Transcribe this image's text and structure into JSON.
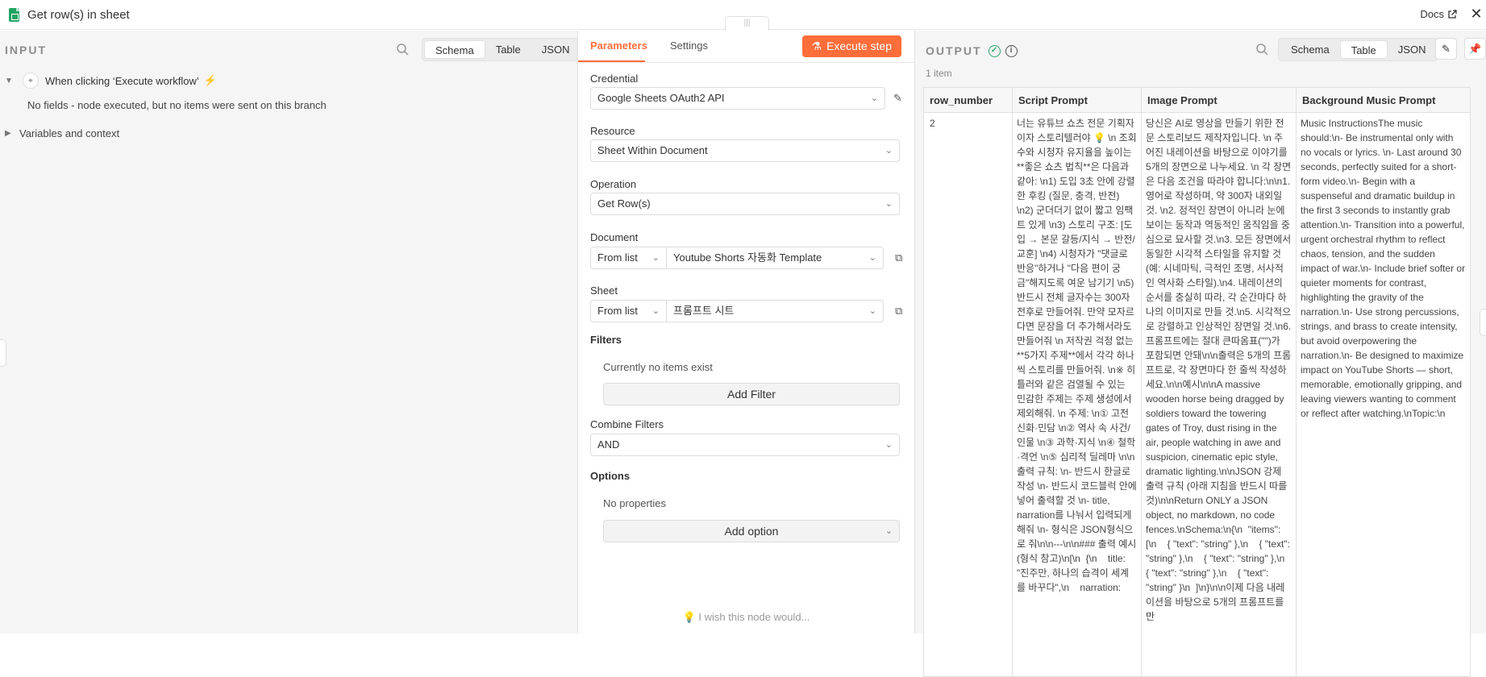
{
  "header": {
    "title": "Get row(s) in sheet",
    "docs_label": "Docs",
    "close_glyph": "✕"
  },
  "input": {
    "heading": "INPUT",
    "view_tabs": [
      "Schema",
      "Table",
      "JSON"
    ],
    "active_tab": "Schema",
    "trigger_label": "When clicking ‘Execute workflow’",
    "no_fields_text": "No fields - node executed, but no items were sent on this branch",
    "variables_label": "Variables and context"
  },
  "params": {
    "tabs": [
      "Parameters",
      "Settings"
    ],
    "execute_label": "Execute step",
    "credential_label": "Credential",
    "credential_value": "Google Sheets OAuth2 API",
    "resource_label": "Resource",
    "resource_value": "Sheet Within Document",
    "operation_label": "Operation",
    "operation_value": "Get Row(s)",
    "document_label": "Document",
    "document_mode": "From list",
    "document_value": "Youtube Shorts 자동화 Template",
    "sheet_label": "Sheet",
    "sheet_mode": "From list",
    "sheet_value": "프롬프트 시트",
    "filters_label": "Filters",
    "filters_empty": "Currently no items exist",
    "add_filter_label": "Add Filter",
    "combine_label": "Combine Filters",
    "combine_value": "AND",
    "options_label": "Options",
    "options_empty": "No properties",
    "add_option_label": "Add option",
    "wish_text": "I wish this node would..."
  },
  "output": {
    "heading": "OUTPUT",
    "view_tabs": [
      "Schema",
      "Table",
      "JSON"
    ],
    "active_tab": "Table",
    "item_count": "1 item",
    "columns": [
      "row_number",
      "Script Prompt",
      "Image Prompt",
      "Background Music Prompt"
    ],
    "row": {
      "row_number": "2",
      "script_prompt": "너는 유튜브 쇼츠 전문 기획자이자 스토리텔러야 💡 \\n 조회수와 시청자 유지율을 높이는 **좋은 쇼츠 법칙**은 다음과 같아: \\n1) 도입 3초 안에 강렬한 후킹 (질문, 충격, 반전) \\n2) 군더더기 없이 짧고 임팩트 있게 \\n3) 스토리 구조: [도입 → 본문 갈등/지식 → 반전/교훈] \\n4) 시청자가 \"댓글로 반응\"하거나 \"다음 편이 궁금\"해지도록 여운 남기기 \\n5) 반드시 전체 글자수는 300자 전후로 만들어줘. 만약 모자르다면 문장을 더 추가해서라도 만들어줘 \\n 저작권 걱정 없는 **5가지 주제**에서 각각 하나씩 스토리를 만들어줘. \\n※ 히틀러와 같은 검열될 수 있는 민감한 주제는 주제 생성에서 제외해줘. \\n 주제: \\n① 고전 신화·민담 \\n② 역사 속 사건/인물 \\n③ 과학·지식 \\n④ 철학·격언 \\n⑤ 심리적 딜레마 \\n\\n출력 규칙: \\n- 반드시 한글로 작성 \\n- 반드시 코드블럭 안에 넣어 출력할 것 \\n- title, narration를 나눠서 입력되게 해줘 \\n- 형식은 JSON형식으로 줘\\n\\n---\\n\\n### 출력 예시 (형식 참고)\\n[\\n  {\\n    title: \"진주만, 하나의 습격이 세계를 바꾸다\",\\n    narration:",
      "image_prompt": "당신은 AI로 영상을 만들기 위한 전문 스토리보드 제작자입니다. \\n 주어진 내레이션을 바탕으로 이야기를 5개의 장면으로 나누세요. \\n 각 장면은 다음 조건을 따라야 합니다:\\n\\n1. 영어로 작성하며, 약 300자 내외일 것. \\n2. 정적인 장면이 아니라 눈에 보이는 동작과 역동적인 움직임을 중심으로 묘사할 것.\\n3. 모든 장면에서 동일한 시각적 스타일을 유지할 것 (예: 시네마틱, 극적인 조명, 서사적인 역사화 스타일).\\n4. 내레이션의 순서를 충실히 따라, 각 순간마다 하나의 이미지로 만들 것.\\n5. 시각적으로 강렬하고 인상적인 장면일 것.\\n6. 프롬프트에는 절대 큰따옴표(\"\")가 포함되면 안돼\\n\\n출력은 5개의 프롬프트로, 각 장면마다 한 줄씩 작성하세요.\\n\\n예시\\n\\nA massive wooden horse being dragged by soldiers toward the towering gates of Troy, dust rising in the air, people watching in awe and suspicion, cinematic epic style, dramatic lighting.\\n\\nJSON 강제 출력 규칙 (아래 지침을 반드시 따를 것)\\n\\nReturn ONLY a JSON object, no markdown, no code fences.\\nSchema:\\n{\\n  \"items\": [\\n    { \"text\": \"string\" },\\n    { \"text\": \"string\" },\\n    { \"text\": \"string\" },\\n    { \"text\": \"string\" },\\n    { \"text\": \"string\" }\\n  ]\\n}\\n\\n이제 다음 내레이션을 바탕으로 5개의 프롬프트를 만",
      "music_prompt": "Music InstructionsThe music should:\\n- Be instrumental only with no vocals or lyrics. \\n- Last around 30 seconds, perfectly suited for a short-form video.\\n- Begin with a suspenseful and dramatic buildup in the first 3 seconds to instantly grab attention.\\n- Transition into a powerful, urgent orchestral rhythm to reflect chaos, tension, and the sudden impact of war.\\n- Include brief softer or quieter moments for contrast, highlighting the gravity of the narration.\\n- Use strong percussions, strings, and brass to create intensity, but avoid overpowering the narration.\\n- Be designed to maximize impact on YouTube Shorts — short, memorable, emotionally gripping, and leaving viewers wanting to comment or reflect after watching.\\nTopic:\\n"
    }
  },
  "colors": {
    "accent": "#ff6d3a",
    "success": "#29a36a",
    "sheets_green": "#1ea362"
  }
}
